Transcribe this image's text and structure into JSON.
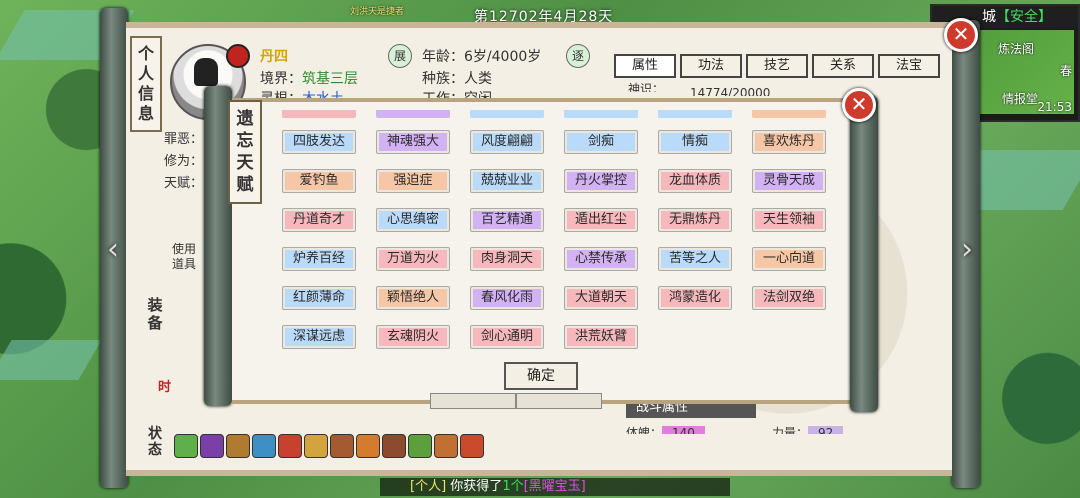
{
  "top": {
    "date": "第12702年4月28天",
    "banner": "刘洪天是捷者"
  },
  "minimap": {
    "title": "城",
    "safe": "【安全】",
    "labels": [
      "炼法阁",
      "情报堂",
      "春"
    ],
    "time": "21:53"
  },
  "character": {
    "name": "丹四",
    "realm_label": "境界：",
    "realm": "筑基三层",
    "root_label": "灵根：",
    "root": "木水土",
    "age_label": "年龄：",
    "age": "6岁/4000岁",
    "race_label": "种族：",
    "race": "人类",
    "work_label": "工作：",
    "work": "空闲",
    "sin_label": "罪恶：",
    "cult_label": "修为：",
    "talent_label": "天赋：",
    "seal_1": "展",
    "seal_2": "逐",
    "hidden_stat": "14774/20000",
    "hidden_stat_label": "神识："
  },
  "panel": {
    "title": "个人信息",
    "use_item": "使用道具",
    "equip": "装备",
    "time_badge": "时",
    "state": "状态",
    "combat": "战斗属性",
    "stat_1_label": "体魄：",
    "stat_1": "140",
    "stat_2_label": "力量：",
    "stat_2": "92"
  },
  "tabs": [
    "属性",
    "功法",
    "技艺",
    "关系",
    "法宝"
  ],
  "talent_dialog": {
    "title": "遗忘天赋",
    "confirm": "确定",
    "talents": [
      {
        "label": "四肢发达",
        "color": "blue"
      },
      {
        "label": "神魂强大",
        "color": "purple"
      },
      {
        "label": "风度翩翩",
        "color": "blue"
      },
      {
        "label": "剑痴",
        "color": "blue"
      },
      {
        "label": "情痴",
        "color": "blue"
      },
      {
        "label": "喜欢炼丹",
        "color": "orange"
      },
      {
        "label": "爱钓鱼",
        "color": "orange"
      },
      {
        "label": "强迫症",
        "color": "orange"
      },
      {
        "label": "兢兢业业",
        "color": "blue"
      },
      {
        "label": "丹火掌控",
        "color": "purple"
      },
      {
        "label": "龙血体质",
        "color": "pink"
      },
      {
        "label": "灵骨天成",
        "color": "purple"
      },
      {
        "label": "丹道奇才",
        "color": "pink"
      },
      {
        "label": "心思缜密",
        "color": "blue"
      },
      {
        "label": "百艺精通",
        "color": "purple"
      },
      {
        "label": "遁出红尘",
        "color": "pink"
      },
      {
        "label": "无鼎炼丹",
        "color": "pink"
      },
      {
        "label": "天生领袖",
        "color": "pink"
      },
      {
        "label": "炉养百经",
        "color": "blue"
      },
      {
        "label": "万道为火",
        "color": "pink"
      },
      {
        "label": "肉身洞天",
        "color": "pink"
      },
      {
        "label": "心禁传承",
        "color": "purple"
      },
      {
        "label": "苦等之人",
        "color": "blue"
      },
      {
        "label": "一心向道",
        "color": "orange"
      },
      {
        "label": "红颜薄命",
        "color": "blue"
      },
      {
        "label": "颖悟绝人",
        "color": "orange"
      },
      {
        "label": "春风化雨",
        "color": "purple"
      },
      {
        "label": "大道朝天",
        "color": "pink"
      },
      {
        "label": "鸿蒙造化",
        "color": "pink"
      },
      {
        "label": "法剑双绝",
        "color": "pink"
      },
      {
        "label": "深谋远虑",
        "color": "blue"
      },
      {
        "label": "玄魂阴火",
        "color": "pink"
      },
      {
        "label": "剑心通明",
        "color": "pink"
      },
      {
        "label": "洪荒妖臂",
        "color": "pink"
      }
    ]
  },
  "chat": {
    "channel": "[个人]",
    "text": "你获得了",
    "count": "1个",
    "item": "[黑曜宝玉]"
  },
  "colors": {
    "blue": "#b9daf9",
    "purple": "#d3b2f4",
    "pink": "#f6b8bd",
    "orange": "#f6c7a6"
  }
}
